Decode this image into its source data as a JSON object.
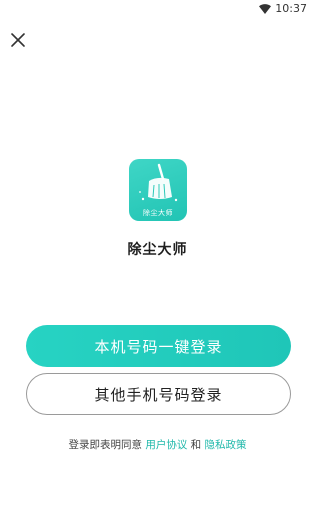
{
  "status_bar": {
    "time": "10:37",
    "wifi_icon": "wifi-icon"
  },
  "header": {
    "close_icon": "close-icon"
  },
  "app": {
    "logo_caption": "除尘大师",
    "name": "除尘大师",
    "logo_icon": "broom-icon",
    "accent_color": "#22c8b8"
  },
  "buttons": {
    "one_click_login": "本机号码一键登录",
    "other_phone_login": "其他手机号码登录"
  },
  "agreement": {
    "prefix": "登录即表明同意",
    "user_agreement": "用户协议",
    "and": "和",
    "privacy_policy": "隐私政策"
  }
}
